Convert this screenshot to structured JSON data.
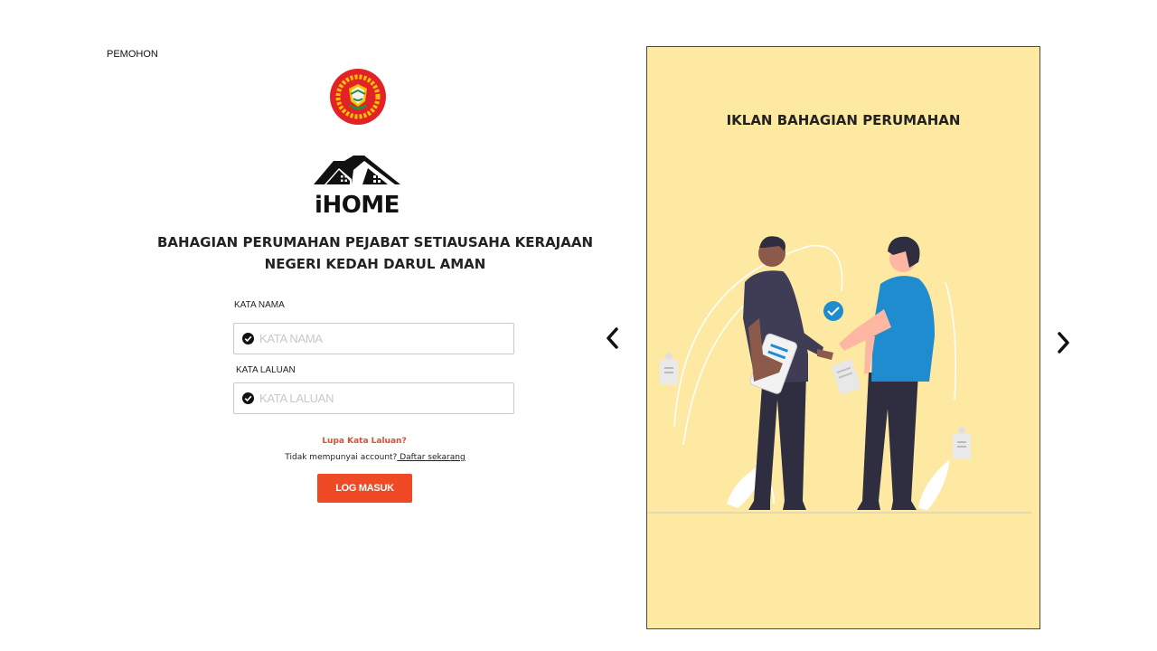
{
  "header": {
    "role_label": "PEMOHON"
  },
  "logo": {
    "text": "iHOME"
  },
  "agency": {
    "line1": "BAHAGIAN PERUMAHAN PEJABAT SETIAUSAHA KERAJAAN",
    "line2": "NEGERI KEDAH DARUL AMAN"
  },
  "form": {
    "username_label": "KATA NAMA",
    "username_placeholder": "KATA NAMA",
    "username_value": "",
    "password_label": "KATA LALUAN",
    "password_placeholder": "KATA LALUAN",
    "password_value": "",
    "forgot_link": "Lupa Kata Laluan?",
    "no_account_text": "Tidak mempunyai account?",
    "register_link": " Daftar sekarang",
    "login_button": "LOG MASUK"
  },
  "carousel": {
    "slide_title": "IKLAN BAHAGIAN PERUMAHAN",
    "prev_icon": "chevron-left-icon",
    "next_icon": "chevron-right-icon"
  },
  "colors": {
    "accent": "#ef4a25",
    "link_red": "#e84a2b",
    "slide_bg": "#fde9a2",
    "crest_red": "#e32227",
    "crest_yellow": "#f5c400",
    "person_blue": "#1e8ccf",
    "person_dark": "#2f2e41",
    "check_blue": "#1e8ccf"
  }
}
